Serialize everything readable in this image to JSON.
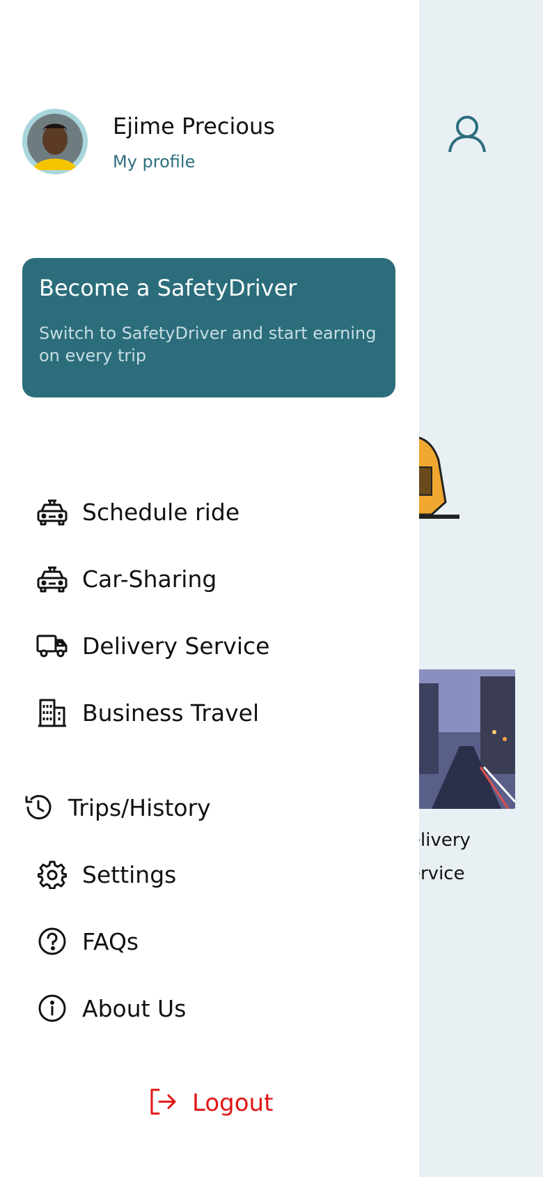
{
  "profile": {
    "name": "Ejime Precious",
    "link": "My profile"
  },
  "promo": {
    "title": "Become a SafetyDriver",
    "subtitle": "Switch to SafetyDriver and start earning on every trip"
  },
  "menu": {
    "services": [
      {
        "label": "Schedule ride",
        "icon": "taxi-icon"
      },
      {
        "label": "Car-Sharing",
        "icon": "taxi-icon"
      },
      {
        "label": "Delivery Service",
        "icon": "truck-icon"
      },
      {
        "label": "Business Travel",
        "icon": "building-icon"
      }
    ],
    "general": [
      {
        "label": "Trips/History",
        "icon": "history-icon"
      },
      {
        "label": "Settings",
        "icon": "gear-icon"
      },
      {
        "label": "FAQs",
        "icon": "question-icon"
      },
      {
        "label": "About Us",
        "icon": "info-icon"
      }
    ]
  },
  "logout": {
    "label": "Logout",
    "icon": "logout-icon"
  },
  "background": {
    "card_label_line1": "elivery",
    "card_label_line2": "ervice"
  },
  "colors": {
    "accent": "#2b6d7b",
    "logout": "#e01515",
    "background": "#e8f0f3"
  }
}
